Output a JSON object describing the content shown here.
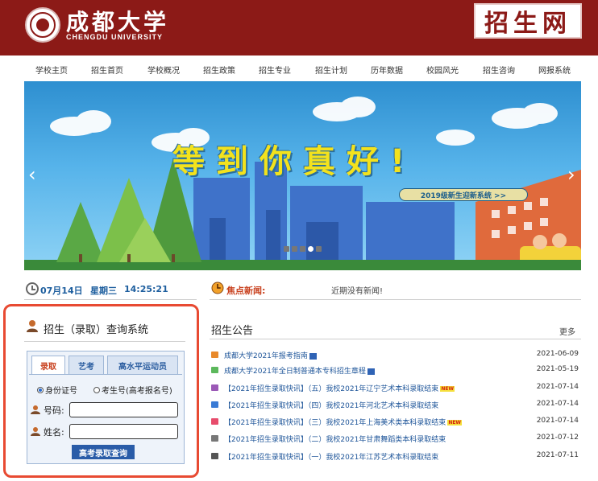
{
  "header": {
    "logo_cn": "成都大学",
    "logo_en": "CHENGDU UNIVERSITY",
    "portal_name": "招生网",
    "brand_color": "#8c1a17"
  },
  "nav": {
    "items": [
      "学校主页",
      "招生首页",
      "学校概况",
      "招生政策",
      "招生专业",
      "招生计划",
      "历年数据",
      "校园风光",
      "招生咨询",
      "网报系统"
    ]
  },
  "banner": {
    "headline": "等到你真好!",
    "pill": "2019级新生迎新系统 >>",
    "prev_icon": "chevron-left-icon",
    "next_icon": "chevron-right-icon",
    "slide_count": 5,
    "active_slide": 4
  },
  "clock": {
    "date": "07月14日",
    "weekday": "星期三",
    "time": "14:25:21"
  },
  "query": {
    "title": "招生（录取）查询系统",
    "tabs": [
      "录取",
      "艺考",
      "高水平运动员"
    ],
    "active_tab": 0,
    "radio_id": "身份证号",
    "radio_exam": "考生号(高考报名号)",
    "radio_selected": "身份证号",
    "number_label": "号码:",
    "name_label": "姓名:",
    "number_value": "",
    "name_value": "",
    "button": "高考录取查询",
    "highlight_color": "#e84a32"
  },
  "focus_news": {
    "label": "焦点新闻:",
    "message": "近期没有新闻!"
  },
  "announcements": {
    "title": "招生公告",
    "more": "更多",
    "items": [
      {
        "text": "成都大学2021年报考指南",
        "date": "2021-06-09",
        "bullet_color": "#e8892a",
        "doc": true,
        "new": false
      },
      {
        "text": "成都大学2021年全日制普通本专科招生章程",
        "date": "2021-05-19",
        "bullet_color": "#5cb85c",
        "doc": true,
        "new": false
      },
      {
        "text": "【2021年招生录取快讯】（五）我校2021年辽宁艺术本科录取结束",
        "date": "2021-07-14",
        "bullet_color": "#9b59b6",
        "doc": false,
        "new": true
      },
      {
        "text": "【2021年招生录取快讯】（四）我校2021年河北艺术本科录取结束",
        "date": "2021-07-14",
        "bullet_color": "#3a7bd5",
        "doc": false,
        "new": false
      },
      {
        "text": "【2021年招生录取快讯】（三）我校2021年上海美术类本科录取结束",
        "date": "2021-07-14",
        "bullet_color": "#e74c6c",
        "doc": false,
        "new": true
      },
      {
        "text": "【2021年招生录取快讯】（二）我校2021年甘肃舞蹈类本科录取结束",
        "date": "2021-07-12",
        "bullet_color": "#777777",
        "doc": false,
        "new": false
      },
      {
        "text": "【2021年招生录取快讯】（一）我校2021年江苏艺术本科录取结束",
        "date": "2021-07-11",
        "bullet_color": "#555555",
        "doc": false,
        "new": false
      }
    ]
  }
}
